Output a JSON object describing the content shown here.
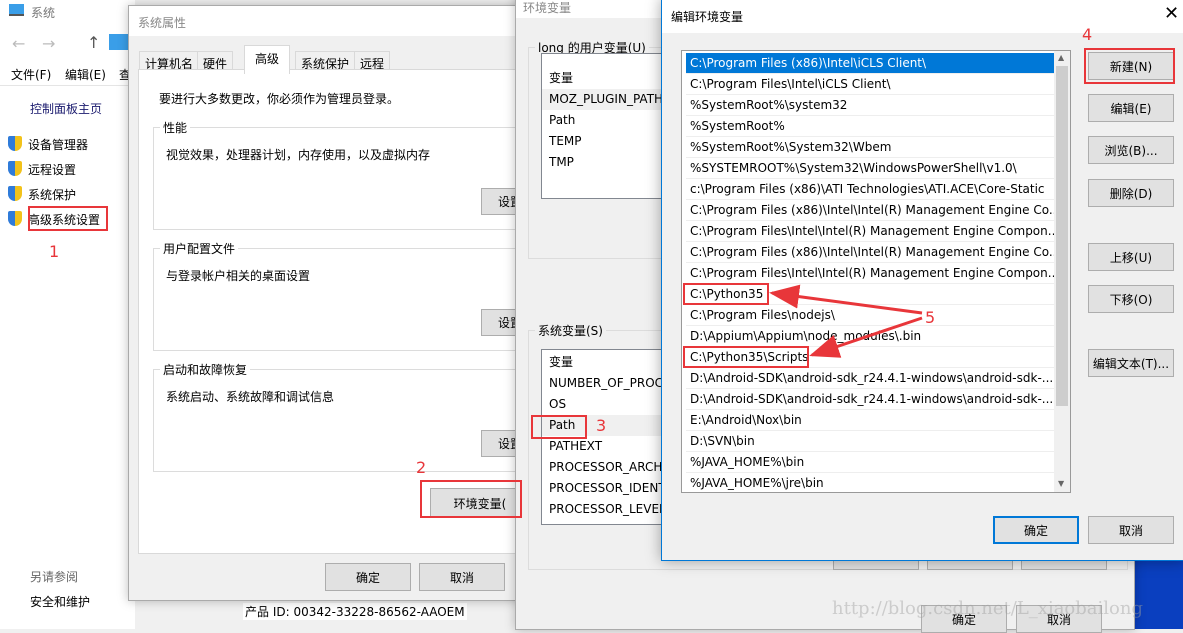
{
  "system_window": {
    "title": "系统",
    "menu": [
      "文件(F)",
      "编辑(E)",
      "查"
    ],
    "home": "控制面板主页",
    "links": [
      "设备管理器",
      "远程设置",
      "系统保护",
      "高级系统设置"
    ],
    "see_also": "另请参阅",
    "security": "安全和维护",
    "product_id": "产品 ID: 00342-33228-86562-AAOEM"
  },
  "sysprops": {
    "title": "系统属性",
    "tabs": [
      "计算机名",
      "硬件",
      "高级",
      "系统保护",
      "远程"
    ],
    "active_tab": "高级",
    "admin_note": "要进行大多数更改，你必须作为管理员登录。",
    "perf": {
      "label": "性能",
      "desc": "视觉效果，处理器计划，内存使用，以及虚拟内存",
      "btn": "设置"
    },
    "profile": {
      "label": "用户配置文件",
      "desc": "与登录帐户相关的桌面设置",
      "btn": "设置"
    },
    "startup": {
      "label": "启动和故障恢复",
      "desc": "系统启动、系统故障和调试信息",
      "btn": "设置"
    },
    "env_btn": "环境变量(",
    "ok": "确定",
    "cancel": "取消"
  },
  "envvars": {
    "title": "环境变量",
    "user_group": "long 的用户变量(U)",
    "user_header": "变量",
    "user_vars": [
      "MOZ_PLUGIN_PATH",
      "Path",
      "TEMP",
      "TMP"
    ],
    "sys_group": "系统变量(S)",
    "sys_header": "变量",
    "sys_vars": [
      "NUMBER_OF_PROC",
      "OS",
      "Path",
      "PATHEXT",
      "PROCESSOR_ARCHI",
      "PROCESSOR_IDENT",
      "PROCESSOR_LEVEL"
    ],
    "selected": "Path",
    "ok": "确定",
    "cancel": "取消"
  },
  "edit": {
    "title": "编辑环境变量",
    "entries": [
      "C:\\Program Files (x86)\\Intel\\iCLS Client\\",
      "C:\\Program Files\\Intel\\iCLS Client\\",
      "%SystemRoot%\\system32",
      "%SystemRoot%",
      "%SystemRoot%\\System32\\Wbem",
      "%SYSTEMROOT%\\System32\\WindowsPowerShell\\v1.0\\",
      "c:\\Program Files (x86)\\ATI Technologies\\ATI.ACE\\Core-Static",
      "C:\\Program Files (x86)\\Intel\\Intel(R) Management Engine Co...",
      "C:\\Program Files\\Intel\\Intel(R) Management Engine Compon...",
      "C:\\Program Files (x86)\\Intel\\Intel(R) Management Engine Co...",
      "C:\\Program Files\\Intel\\Intel(R) Management Engine Compon...",
      "C:\\Python35",
      "C:\\Program Files\\nodejs\\",
      "D:\\Appium\\Appium\\node_modules\\.bin",
      "C:\\Python35\\Scripts",
      "D:\\Android-SDK\\android-sdk_r24.4.1-windows\\android-sdk-...",
      "D:\\Android-SDK\\android-sdk_r24.4.1-windows\\android-sdk-...",
      "E:\\Android\\Nox\\bin",
      "D:\\SVN\\bin",
      "%JAVA_HOME%\\bin",
      "%JAVA_HOME%\\jre\\bin"
    ],
    "selected_index": 0,
    "buttons": [
      "新建(N)",
      "编辑(E)",
      "浏览(B)...",
      "删除(D)",
      "上移(U)",
      "下移(O)",
      "编辑文本(T)..."
    ],
    "ok": "确定",
    "cancel": "取消"
  },
  "annotations": [
    "1",
    "2",
    "3",
    "4",
    "5"
  ],
  "watermark": "http://blog.csdn.net/L_xiaobailong",
  "colors": {
    "accent": "#0078d7",
    "annotation": "#e8363a",
    "selection": "#cce8ff",
    "desktop": "#0a3fbf"
  }
}
